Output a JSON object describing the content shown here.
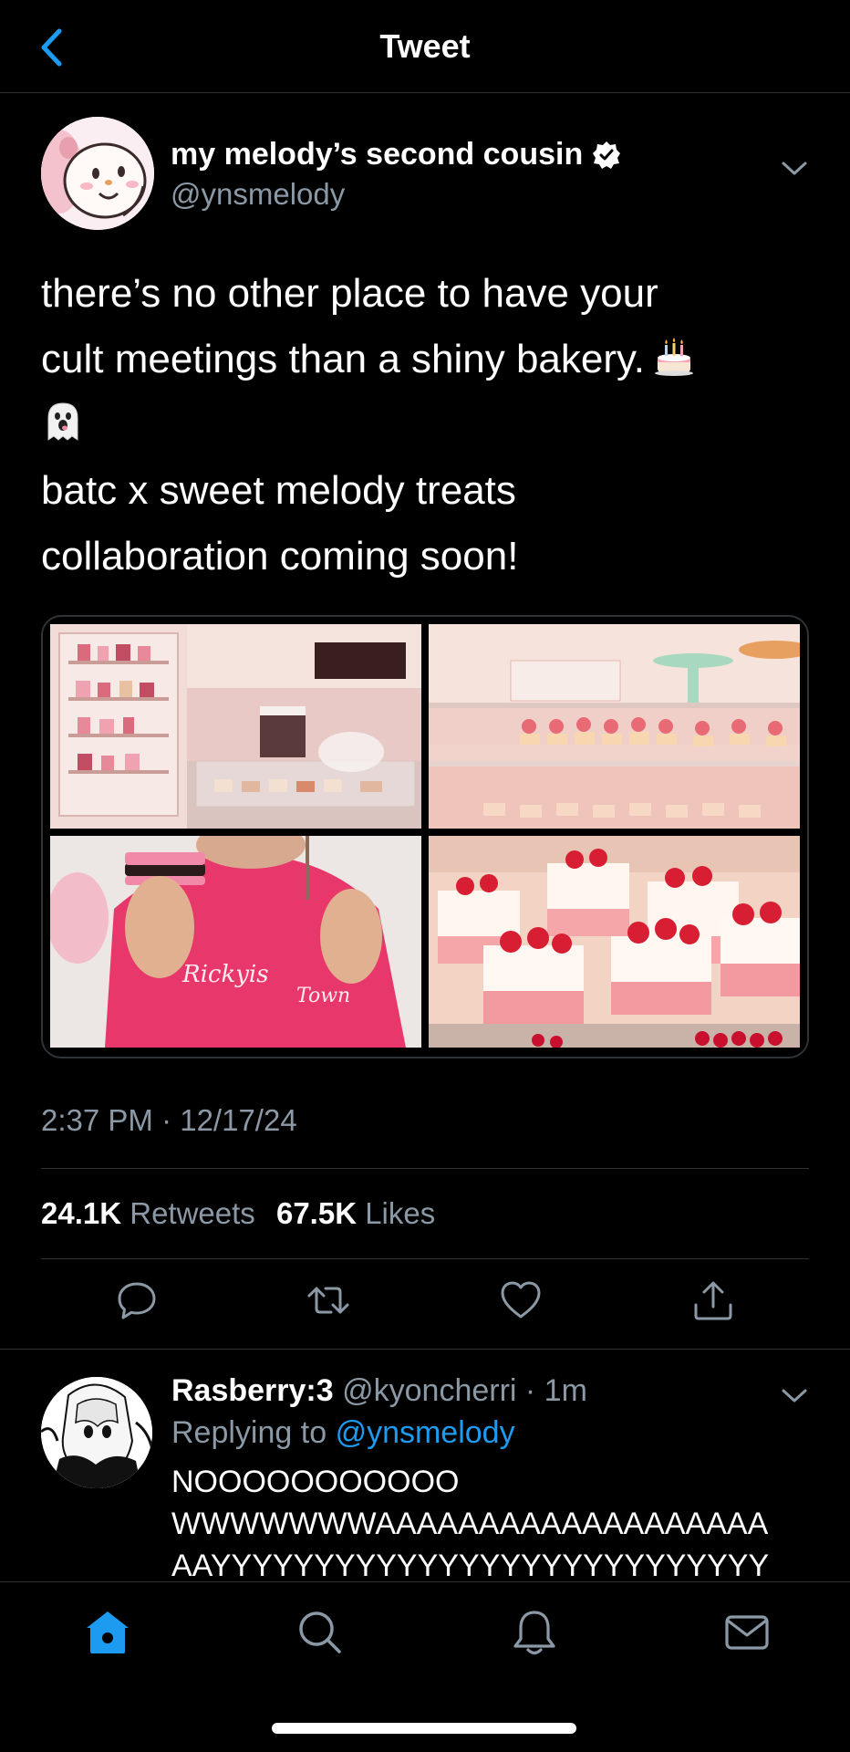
{
  "header": {
    "title": "Tweet",
    "back_icon": "back-chevron-icon",
    "accent": "#1d9bf0"
  },
  "tweet": {
    "author": {
      "name": "my melody’s second cousin",
      "handle": "@ynsmelody",
      "verified": true
    },
    "text_lines": [
      "there’s no other place to have your",
      "cult meetings than a shiny bakery.",
      "batc x sweet melody treats",
      "collaboration coming soon!"
    ],
    "emojis": [
      "birthday-cake-emoji",
      "ghost-emoji"
    ],
    "media_count": 4,
    "timestamp": "2:37 PM · 12/17/24",
    "stats": {
      "retweets_count": "24.1K",
      "retweets_label": "Retweets",
      "likes_count": "67.5K",
      "likes_label": "Likes"
    },
    "actions": [
      "reply-icon",
      "retweet-icon",
      "like-icon",
      "share-icon"
    ]
  },
  "reply": {
    "name": "Rasberry:3",
    "meta": "@kyoncherri · 1m",
    "replying_prefix": "Replying to",
    "replying_to": "@ynsmelody",
    "text_lines": [
      "Nooooooooooo",
      "wwwwwwwaaaaaaaaaaaaaaaaaaa",
      "aayyyyyyyyyyyyyyyyyyyyyyyyyyy"
    ]
  },
  "tabbar": {
    "items": [
      "home-icon",
      "search-icon",
      "notifications-icon",
      "messages-icon"
    ],
    "active": "home-icon"
  }
}
